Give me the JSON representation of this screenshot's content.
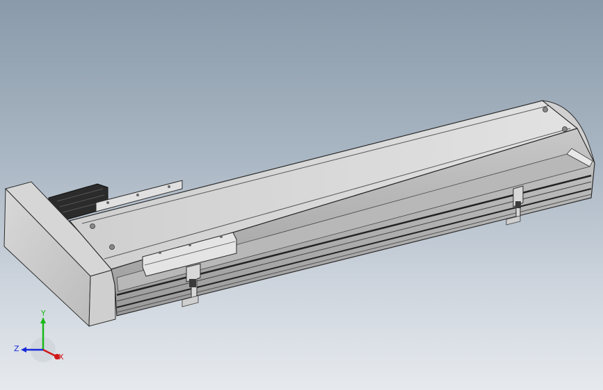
{
  "viewport": {
    "background_top": "#8a9aaa",
    "background_bottom": "#e6eaee"
  },
  "model": {
    "body_color": "#dcdcdc",
    "edge_color": "#2a2a2a",
    "motor_color": "#2b2b2b"
  },
  "triad": {
    "x_label": "X",
    "y_label": "Y",
    "z_label": "Z",
    "x_color": "#d01818",
    "y_color": "#18b818",
    "z_color": "#1a2ad8"
  }
}
